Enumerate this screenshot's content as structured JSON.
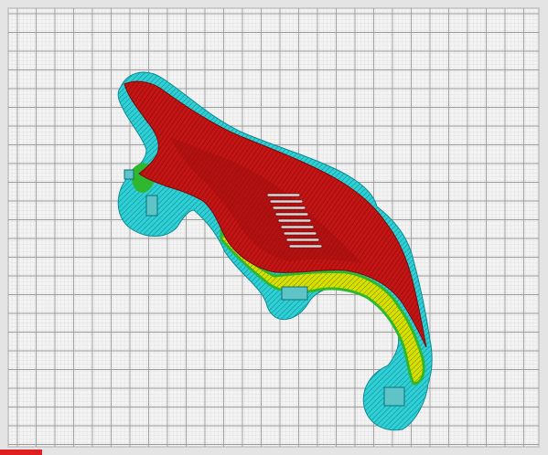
{
  "viewport": {
    "view": "top",
    "colors": {
      "plate_background": "#e4e4e4",
      "plate_border": "#c9c9c9",
      "grid_line": "#9a9a9a",
      "cell_fill": "#f4f4f4",
      "model_surface": "#c41414",
      "model_surface_dark": "#8e0b0b",
      "model_highlight": "#e23030",
      "skirt_brim": "#2fd0d6",
      "skirt_brim_dark": "#0f8b92",
      "support": "#5ec4c8",
      "wall_inner": "#d8e000",
      "wall_outer": "#2fb82f",
      "axis_x": "#e02020"
    },
    "icons": [
      "build-plate-grid",
      "sliced-model",
      "axis-indicator"
    ]
  }
}
